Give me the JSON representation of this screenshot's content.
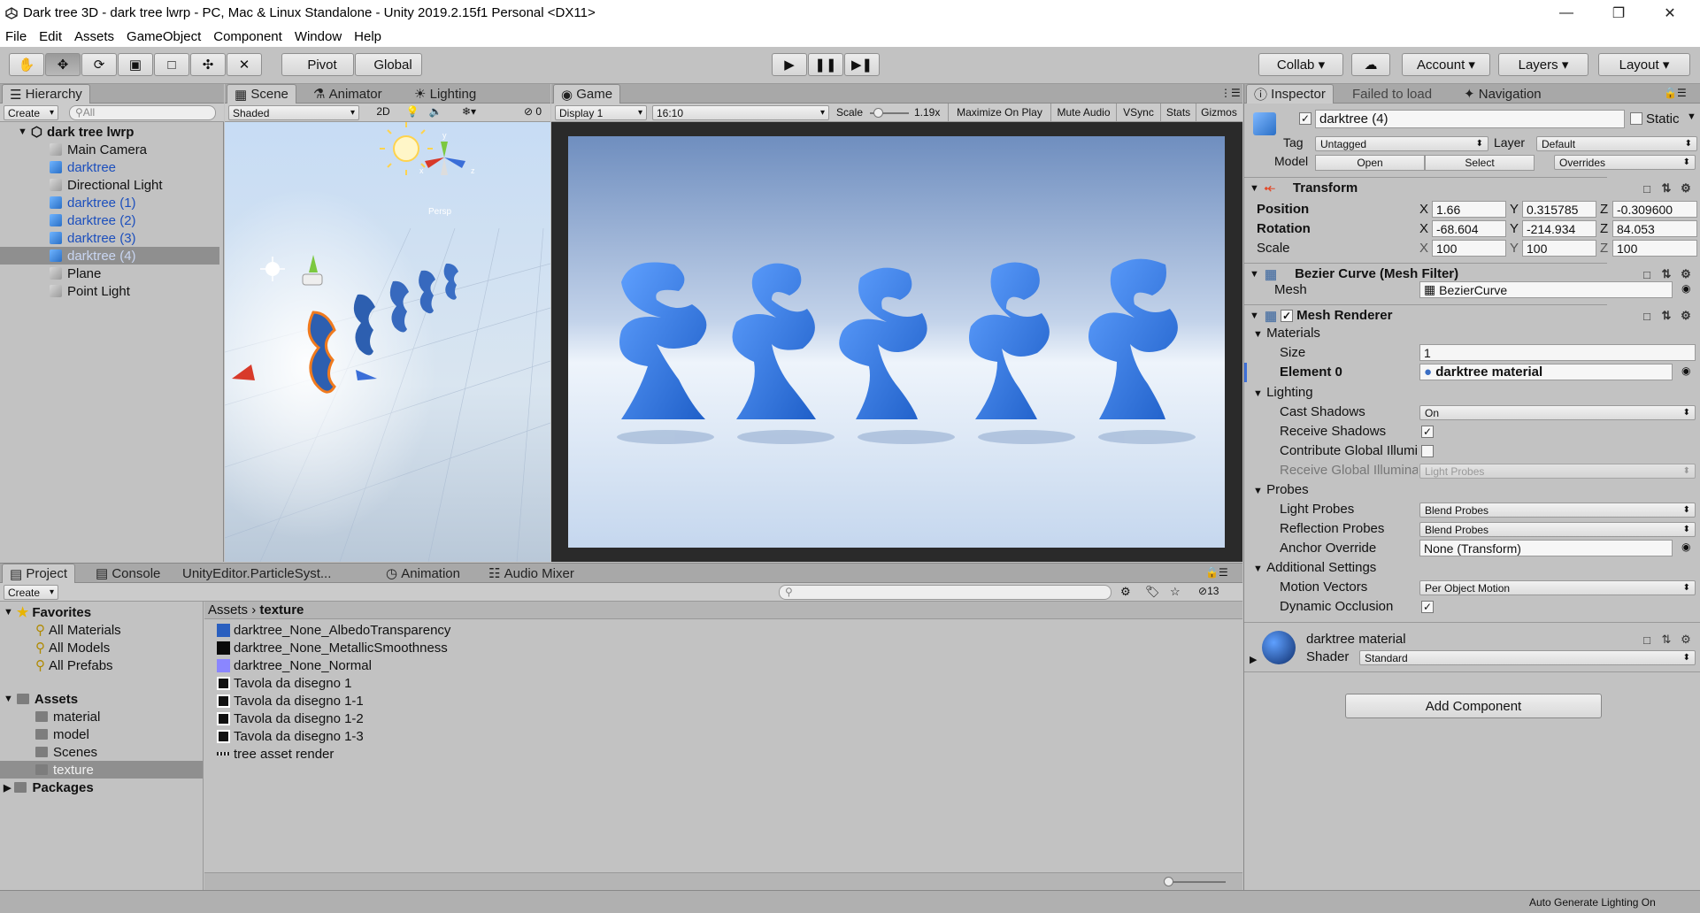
{
  "window": {
    "title": "Dark tree 3D - dark tree lwrp - PC, Mac & Linux Standalone - Unity 2019.2.15f1 Personal <DX11>"
  },
  "menu": [
    "File",
    "Edit",
    "Assets",
    "GameObject",
    "Component",
    "Window",
    "Help"
  ],
  "toolbar": {
    "pivot_label": "Pivot",
    "global_label": "Global",
    "collab_label": "Collab",
    "account_label": "Account",
    "layers_label": "Layers",
    "layout_label": "Layout"
  },
  "hierarchy": {
    "tab_label": "Hierarchy",
    "create_label": "Create",
    "search_placeholder": "All",
    "scene_name": "dark tree lwrp",
    "items": [
      {
        "label": "Main Camera"
      },
      {
        "label": "darktree"
      },
      {
        "label": "Directional Light"
      },
      {
        "label": "darktree (1)"
      },
      {
        "label": "darktree (2)"
      },
      {
        "label": "darktree (3)"
      },
      {
        "label": "darktree (4)"
      },
      {
        "label": "Plane"
      },
      {
        "label": "Point Light"
      }
    ]
  },
  "scene": {
    "tabs": [
      "Scene",
      "Animator",
      "Lighting"
    ],
    "shading": "Shaded",
    "mode_2d": "2D",
    "hidden_count": "0",
    "persp_label": "Persp"
  },
  "game": {
    "tab_label": "Game",
    "display": "Display 1",
    "aspect": "16:10",
    "scale_label": "Scale",
    "scale_value": "1.19x",
    "buttons": [
      "Maximize On Play",
      "Mute Audio",
      "VSync",
      "Stats",
      "Gizmos"
    ]
  },
  "project": {
    "tabs": [
      "Project",
      "Console",
      "UnityEditor.ParticleSyst...",
      "Animation",
      "Audio Mixer"
    ],
    "create_label": "Create",
    "hidden_count": "13",
    "favorites_label": "Favorites",
    "favorites": [
      "All Materials",
      "All Models",
      "All Prefabs"
    ],
    "assets_label": "Assets",
    "asset_folders": [
      "material",
      "model",
      "Scenes",
      "texture"
    ],
    "packages_label": "Packages",
    "breadcrumb_root": "Assets",
    "breadcrumb_current": "texture",
    "files": [
      "darktree_None_AlbedoTransparency",
      "darktree_None_MetallicSmoothness",
      "darktree_None_Normal",
      "Tavola da disegno 1",
      "Tavola da disegno 1-1",
      "Tavola da disegno 1-2",
      "Tavola da disegno 1-3",
      "tree asset render"
    ]
  },
  "inspector": {
    "tabs": [
      "Inspector",
      "Failed to load",
      "Navigation"
    ],
    "object_name": "darktree (4)",
    "static_label": "Static",
    "tag_label": "Tag",
    "tag_value": "Untagged",
    "layer_label": "Layer",
    "layer_value": "Default",
    "model_label": "Model",
    "open_label": "Open",
    "select_label": "Select",
    "overrides_label": "Overrides",
    "transform": {
      "title": "Transform",
      "position_label": "Position",
      "rotation_label": "Rotation",
      "scale_label": "Scale",
      "position": {
        "x": "1.66",
        "y": "0.315785",
        "z": "-0.309600"
      },
      "rotation": {
        "x": "-68.604",
        "y": "-214.934",
        "z": "84.053"
      },
      "scale": {
        "x": "100",
        "y": "100",
        "z": "100"
      }
    },
    "mesh_filter": {
      "title": "Bezier Curve (Mesh Filter)",
      "mesh_label": "Mesh",
      "mesh_value": "BezierCurve"
    },
    "mesh_renderer": {
      "title": "Mesh Renderer",
      "materials_label": "Materials",
      "size_label": "Size",
      "size_value": "1",
      "element0_label": "Element 0",
      "element0_value": "darktree material",
      "lighting_label": "Lighting",
      "cast_shadows_label": "Cast Shadows",
      "cast_shadows_value": "On",
      "receive_shadows_label": "Receive Shadows",
      "contribute_gi_label": "Contribute Global Illumi",
      "receive_gi_label": "Receive Global Illuminat",
      "receive_gi_value": "Light Probes",
      "probes_label": "Probes",
      "light_probes_label": "Light Probes",
      "light_probes_value": "Blend Probes",
      "reflection_probes_label": "Reflection Probes",
      "reflection_probes_value": "Blend Probes",
      "anchor_override_label": "Anchor Override",
      "anchor_override_value": "None (Transform)",
      "additional_label": "Additional Settings",
      "motion_vectors_label": "Motion Vectors",
      "motion_vectors_value": "Per Object Motion",
      "dynamic_occlusion_label": "Dynamic Occlusion"
    },
    "material": {
      "name": "darktree material",
      "shader_label": "Shader",
      "shader_value": "Standard"
    },
    "add_component_label": "Add Component"
  },
  "status": {
    "text": "Auto Generate Lighting On"
  },
  "colors": {
    "tree_blue": "#3a7ee0",
    "selection_blue": "#3d6fd8",
    "editor_gray": "#c2c2c2"
  }
}
